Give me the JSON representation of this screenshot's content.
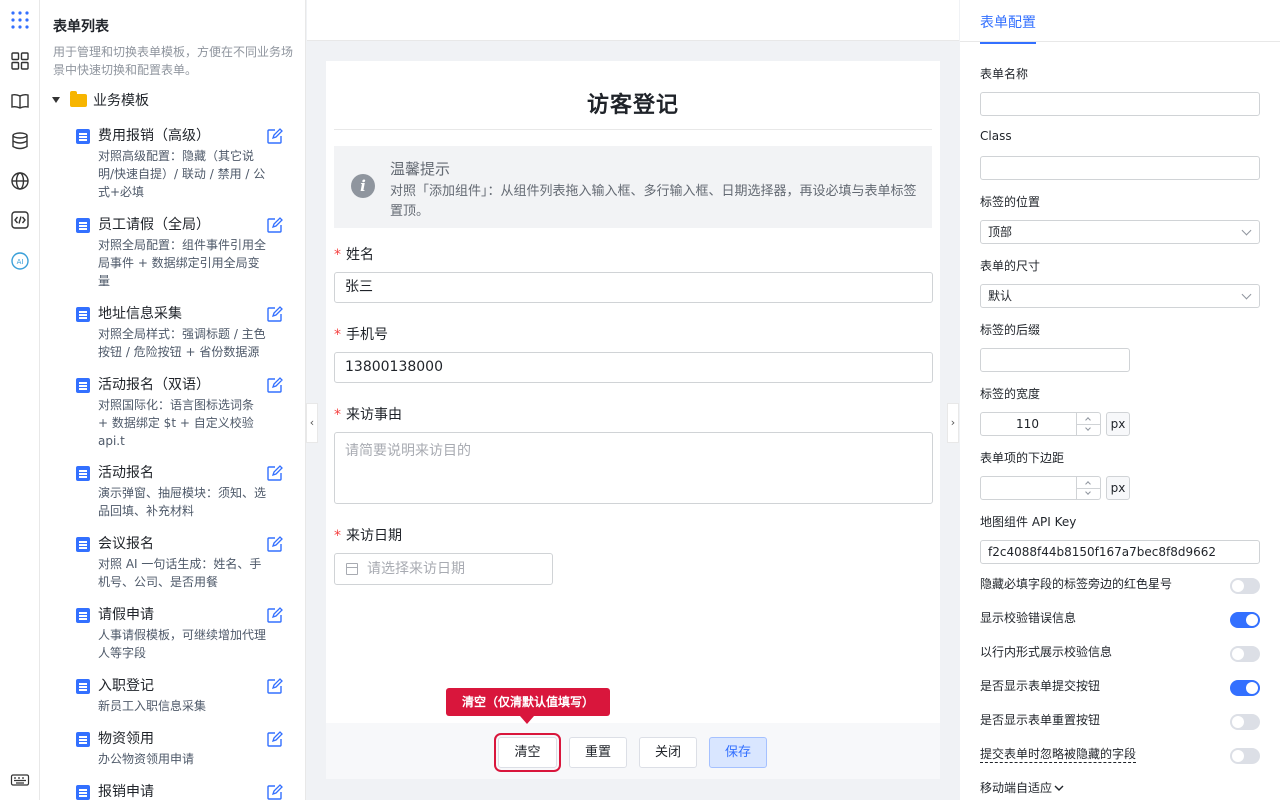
{
  "sidebar": {
    "title": "表单列表",
    "description": "用于管理和切换表单模板，方便在不同业务场景中快速切换和配置表单。",
    "folder": "业务模板",
    "items": [
      {
        "name": "费用报销（高级）",
        "desc": "对照高级配置：隐藏（其它说明/快速自提）/ 联动 / 禁用 / 公式+必填"
      },
      {
        "name": "员工请假（全局）",
        "desc": "对照全局配置：组件事件引用全局事件 + 数据绑定引用全局变量"
      },
      {
        "name": "地址信息采集",
        "desc": "对照全局样式：强调标题 / 主色按钮 / 危险按钮 + 省份数据源"
      },
      {
        "name": "活动报名（双语）",
        "desc": "对照国际化：语言图标选词条 + 数据绑定 $t + 自定义校验 api.t"
      },
      {
        "name": "活动报名",
        "desc": "演示弹窗、抽屉模块：须知、选品回填、补充材料"
      },
      {
        "name": "会议报名",
        "desc": "对照 AI 一句话生成：姓名、手机号、公司、是否用餐"
      },
      {
        "name": "请假申请",
        "desc": "人事请假模板，可继续增加代理人等字段"
      },
      {
        "name": "入职登记",
        "desc": "新员工入职信息采集"
      },
      {
        "name": "物资领用",
        "desc": "办公物资领用申请"
      },
      {
        "name": "报销申请",
        "desc": ""
      }
    ]
  },
  "form": {
    "title": "访客登记",
    "tip_title": "温馨提示",
    "tip_text": "对照「添加组件」：从组件列表拖入输入框、多行输入框、日期选择器，再设必填与表单标签置顶。",
    "required_mark": "*",
    "fields": {
      "name": {
        "label": "姓名",
        "value": "张三"
      },
      "phone": {
        "label": "手机号",
        "value": "13800138000"
      },
      "reason": {
        "label": "来访事由",
        "placeholder": "请简要说明来访目的"
      },
      "date": {
        "label": "来访日期",
        "placeholder": "请选择来访日期"
      }
    },
    "buttons": {
      "clear": "清空",
      "reset": "重置",
      "close": "关闭",
      "save": "保存"
    },
    "callout": "清空（仅清默认值填写）"
  },
  "config": {
    "tab": "表单配置",
    "form_name_label": "表单名称",
    "form_name_value": "",
    "class_label": "Class",
    "class_value": "",
    "label_position_label": "标签的位置",
    "label_position_value": "顶部",
    "form_size_label": "表单的尺寸",
    "form_size_value": "默认",
    "label_suffix_label": "标签的后缀",
    "label_suffix_value": "",
    "label_width_label": "标签的宽度",
    "label_width_value": "110",
    "unit_px": "px",
    "item_margin_label": "表单项的下边距",
    "item_margin_value": "",
    "map_key_label": "地图组件 API Key",
    "map_key_value": "f2c4088f44b8150f167a7bec8f8d9662",
    "toggles": [
      {
        "label": "隐藏必填字段的标签旁边的红色星号",
        "on": false
      },
      {
        "label": "显示校验错误信息",
        "on": true
      },
      {
        "label": "以行内形式展示校验信息",
        "on": false
      },
      {
        "label": "是否显示表单提交按钮",
        "on": true
      },
      {
        "label": "是否显示表单重置按钮",
        "on": false
      },
      {
        "label": "提交表单时忽略被隐藏的字段",
        "on": false
      }
    ],
    "mobile_label": "移动端自适应"
  },
  "colors": {
    "accent": "#3370ff",
    "danger": "#d9163c",
    "folder": "#f7b500"
  }
}
